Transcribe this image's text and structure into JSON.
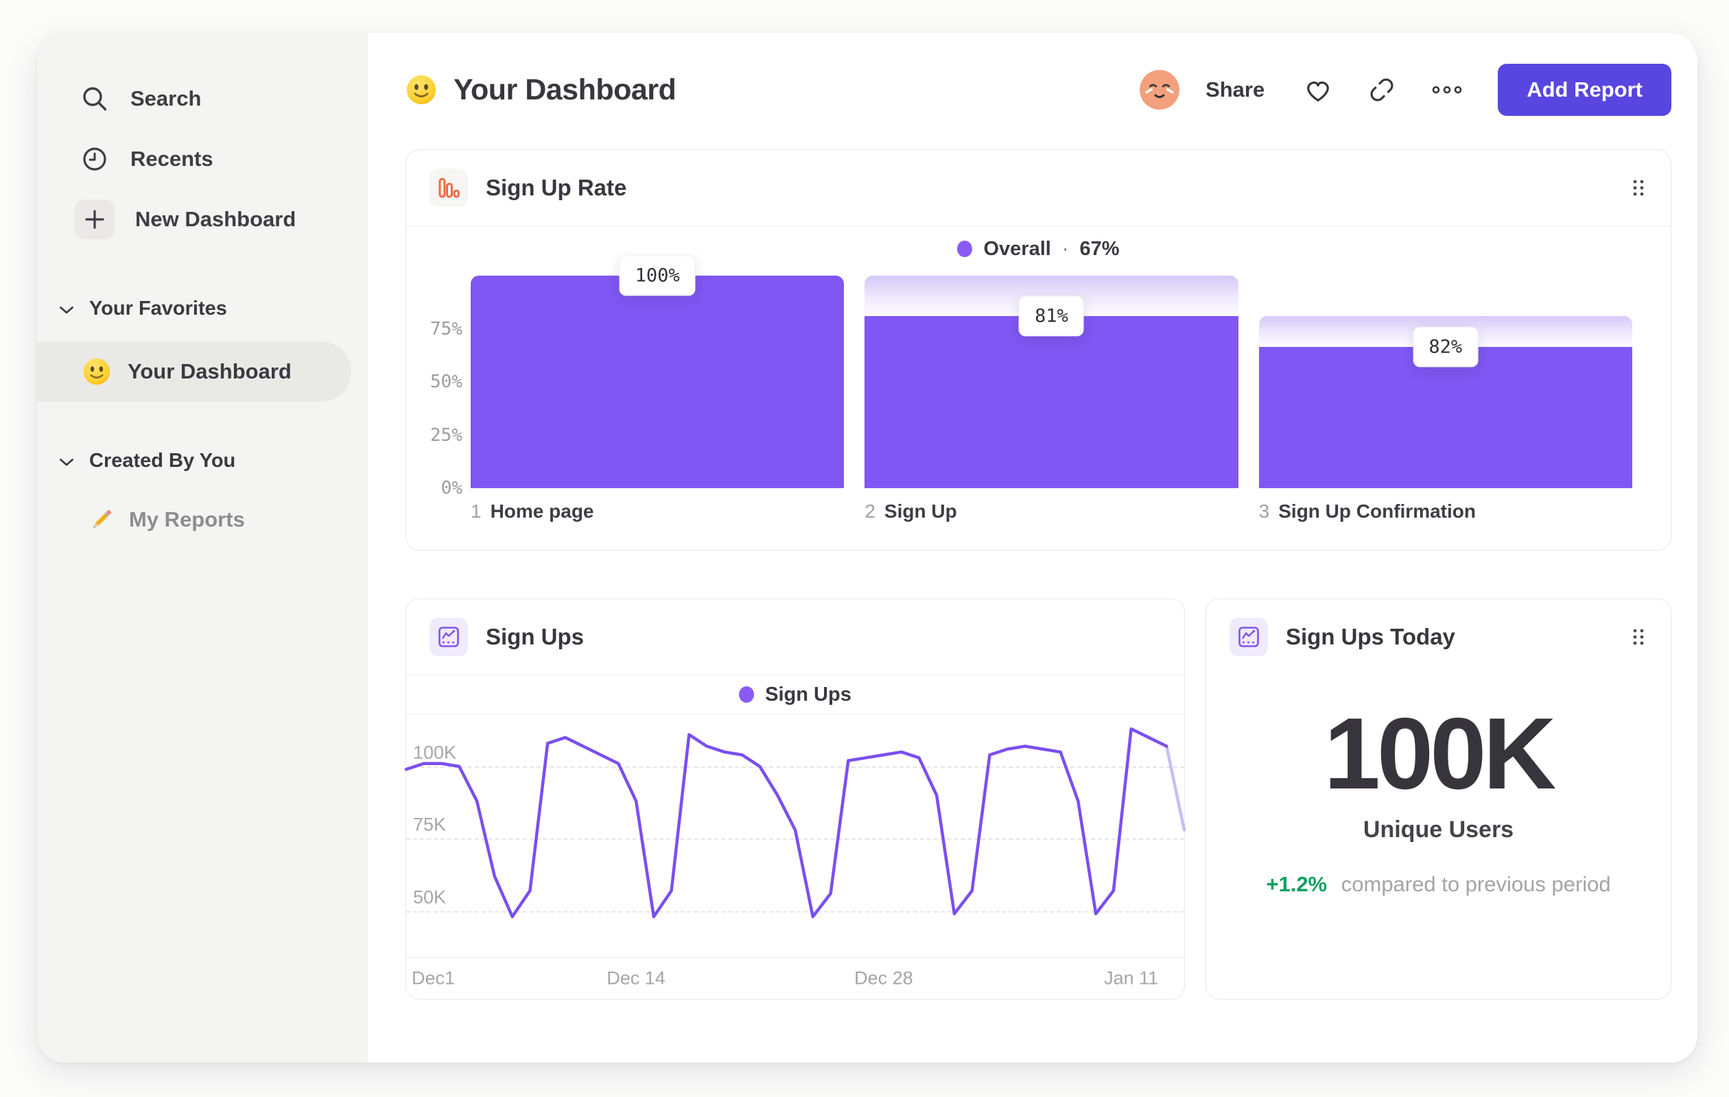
{
  "sidebar": {
    "primary": [
      {
        "label": "Search",
        "icon": "search-icon"
      },
      {
        "label": "Recents",
        "icon": "recents-clock-icon"
      },
      {
        "label": "New Dashboard",
        "icon": "plus-icon"
      }
    ],
    "sections": [
      {
        "label": "Your Favorites",
        "items": [
          {
            "label": "Your Dashboard",
            "icon": "smiley-emoji",
            "selected": true
          }
        ]
      },
      {
        "label": "Created By You",
        "items": [
          {
            "label": "My Reports",
            "icon": "pencil-emoji",
            "selected": false
          }
        ]
      }
    ]
  },
  "header": {
    "title": "Your Dashboard",
    "share_label": "Share",
    "add_report_label": "Add Report"
  },
  "colors": {
    "accent_purple": "#7f57f2",
    "legend_purple": "#8a5bf4",
    "button_purple": "#5746e0",
    "positive_green": "#0fa05f",
    "funnel_icon_orange": "#ee6a45"
  },
  "chart_data": [
    {
      "type": "bar",
      "card_title": "Sign Up Rate",
      "legend": {
        "series": "Overall",
        "separator": "·",
        "value": "67%"
      },
      "legend_position": "top-center",
      "categories": [
        {
          "index": "1",
          "label": "Home page"
        },
        {
          "index": "2",
          "label": "Sign Up"
        },
        {
          "index": "3",
          "label": "Sign Up Confirmation"
        }
      ],
      "step_conversion_labels": [
        "100%",
        "81%",
        "82%"
      ],
      "step_conversion_values": [
        100,
        81,
        82
      ],
      "absolute_heights_pct": [
        100,
        81,
        66.4
      ],
      "yticks": [
        {
          "label": "75%",
          "value": 75
        },
        {
          "label": "50%",
          "value": 50
        },
        {
          "label": "25%",
          "value": 25
        },
        {
          "label": "0%",
          "value": 0
        }
      ],
      "ylim": [
        0,
        100
      ],
      "grid": false
    },
    {
      "type": "line",
      "card_title": "Sign Ups",
      "legend": {
        "series": "Sign Ups"
      },
      "legend_position": "top-center",
      "values_thousands": [
        99,
        101,
        101,
        100,
        88,
        62,
        48,
        57,
        108,
        110,
        107,
        104,
        101,
        88,
        48,
        57,
        111,
        107,
        105,
        104,
        100,
        90,
        78,
        48,
        56,
        102,
        103,
        104,
        105,
        103,
        90,
        49,
        57,
        104,
        106,
        107,
        106,
        105,
        88,
        49,
        57,
        113,
        110,
        107,
        78
      ],
      "xticks": [
        {
          "label": "Dec1",
          "index": 0
        },
        {
          "label": "Dec 14",
          "index": 13
        },
        {
          "label": "Dec 28",
          "index": 27
        },
        {
          "label": "Jan 11",
          "index": 41
        }
      ],
      "yticks": [
        {
          "label": "100K",
          "value": 100
        },
        {
          "label": "75K",
          "value": 75
        },
        {
          "label": "50K",
          "value": 50
        }
      ],
      "ylim_thousands": [
        34,
        118
      ],
      "faded_from_index": 43,
      "grid": "dashed-horizontal"
    },
    {
      "type": "metric",
      "card_title": "Sign Ups Today",
      "value": "100K",
      "label": "Unique Users",
      "delta": "+1.2%",
      "delta_direction": "up",
      "delta_context": "compared to previous period"
    }
  ]
}
